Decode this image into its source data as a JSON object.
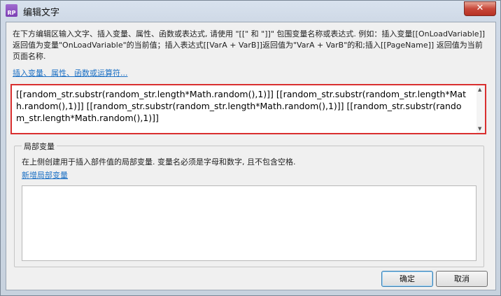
{
  "window": {
    "title": "编辑文字",
    "app_icon_text": "RP",
    "close_symbol": "✕"
  },
  "description": "在下方编辑区输入文字、插入变量、属性、函数或表达式, 请使用 \"[[\" 和 \"]]\" 包围变量名称或表达式. 例如：插入变量[[OnLoadVariable]]返回值为变量\"OnLoadVariable\"的当前值；插入表达式[[VarA + VarB]]返回值为\"VarA + VarB\"的和;插入[[PageName]] 返回值为当前页面名称.",
  "insert_link": "插入变量、属性、函数或运算符...",
  "editor": {
    "value": "[[random_str.substr(random_str.length*Math.random(),1)]] [[random_str.substr(random_str.length*Math.random(),1)]] [[random_str.substr(random_str.length*Math.random(),1)]] [[random_str.substr(random_str.length*Math.random(),1)]]"
  },
  "local_vars": {
    "legend": "局部变量",
    "desc": "在上侧创建用于插入部件值的局部变量. 变量名必须是字母和数字, 且不包含空格.",
    "add_link": "新增局部变量"
  },
  "buttons": {
    "ok": "确定",
    "cancel": "取消"
  },
  "colors": {
    "highlight_border": "#d92f2f",
    "link": "#1a6fc4",
    "close_button": "#c8483a"
  }
}
